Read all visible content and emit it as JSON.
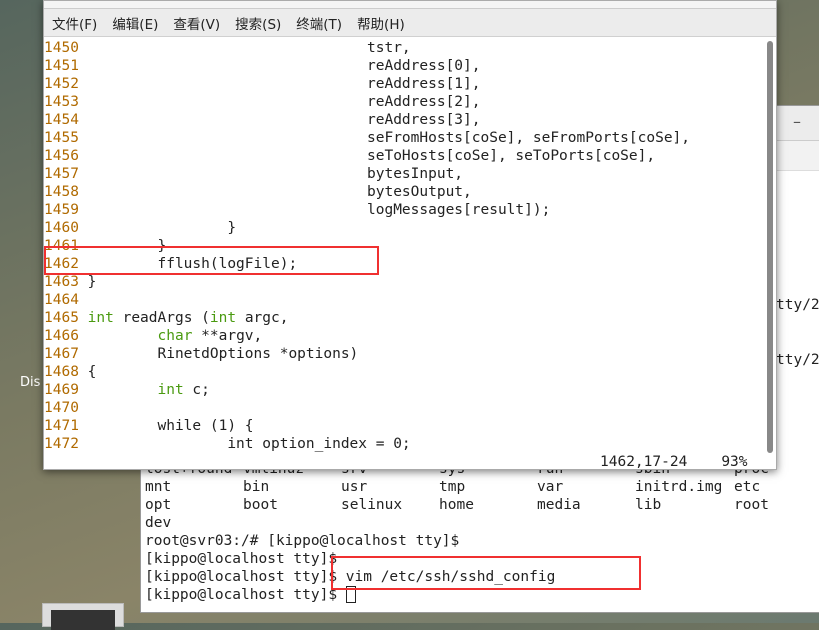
{
  "desktop": {
    "icon_label": "Dis"
  },
  "back_terminal": {
    "minimize": "–",
    "side_texts": [
      "tty/2",
      "tty/2"
    ],
    "ls_rows": [
      [
        "lost+found",
        "vmlinuz",
        "srv",
        "sys",
        "run",
        "sbin",
        "proc"
      ],
      [
        "mnt",
        "bin",
        "usr",
        "tmp",
        "var",
        "initrd.img",
        "etc"
      ],
      [
        "opt",
        "boot",
        "selinux",
        "home",
        "media",
        "lib",
        "root"
      ],
      [
        "dev"
      ]
    ],
    "lines": [
      "root@svr03:/# [kippo@localhost tty]$",
      "[kippo@localhost tty]$",
      "[kippo@localhost tty]$ vim /etc/ssh/sshd_config",
      "[kippo@localhost tty]$ "
    ]
  },
  "front_terminal": {
    "menu": [
      "文件(F)",
      "编辑(E)",
      "查看(V)",
      "搜索(S)",
      "终端(T)",
      "帮助(H)"
    ],
    "lines": [
      {
        "n": "1450",
        "code": "                                tstr,"
      },
      {
        "n": "1451",
        "code": "                                reAddress[0],"
      },
      {
        "n": "1452",
        "code": "                                reAddress[1],"
      },
      {
        "n": "1453",
        "code": "                                reAddress[2],"
      },
      {
        "n": "1454",
        "code": "                                reAddress[3],"
      },
      {
        "n": "1455",
        "code": "                                seFromHosts[coSe], seFromPorts[coSe],"
      },
      {
        "n": "1456",
        "code": "                                seToHosts[coSe], seToPorts[coSe],"
      },
      {
        "n": "1457",
        "code": "                                bytesInput,"
      },
      {
        "n": "1458",
        "code": "                                bytesOutput,"
      },
      {
        "n": "1459",
        "code": "                                logMessages[result]);"
      },
      {
        "n": "1460",
        "code": "                }"
      },
      {
        "n": "1461",
        "code": "        }"
      },
      {
        "n": "1462",
        "code": "        fflush(logFile);"
      },
      {
        "n": "1463",
        "code": "}"
      },
      {
        "n": "1464",
        "code": ""
      },
      {
        "n": "1465",
        "code": "int readArgs (int argc,"
      },
      {
        "n": "1466",
        "code": "        char **argv,"
      },
      {
        "n": "1467",
        "code": "        RinetdOptions *options)"
      },
      {
        "n": "1468",
        "code": "{"
      },
      {
        "n": "1469",
        "code": "        int c;"
      },
      {
        "n": "1470",
        "code": ""
      },
      {
        "n": "1471",
        "code": "        while (1) {"
      },
      {
        "n": "1472",
        "code": "                int option_index = 0;"
      }
    ],
    "status_position": "1462,17-24",
    "status_percent": "93%"
  },
  "colors": {
    "line_number": "#b06a00",
    "keyword": "#4a9a10",
    "number": "#c00000",
    "highlight_box": "#f03030"
  }
}
